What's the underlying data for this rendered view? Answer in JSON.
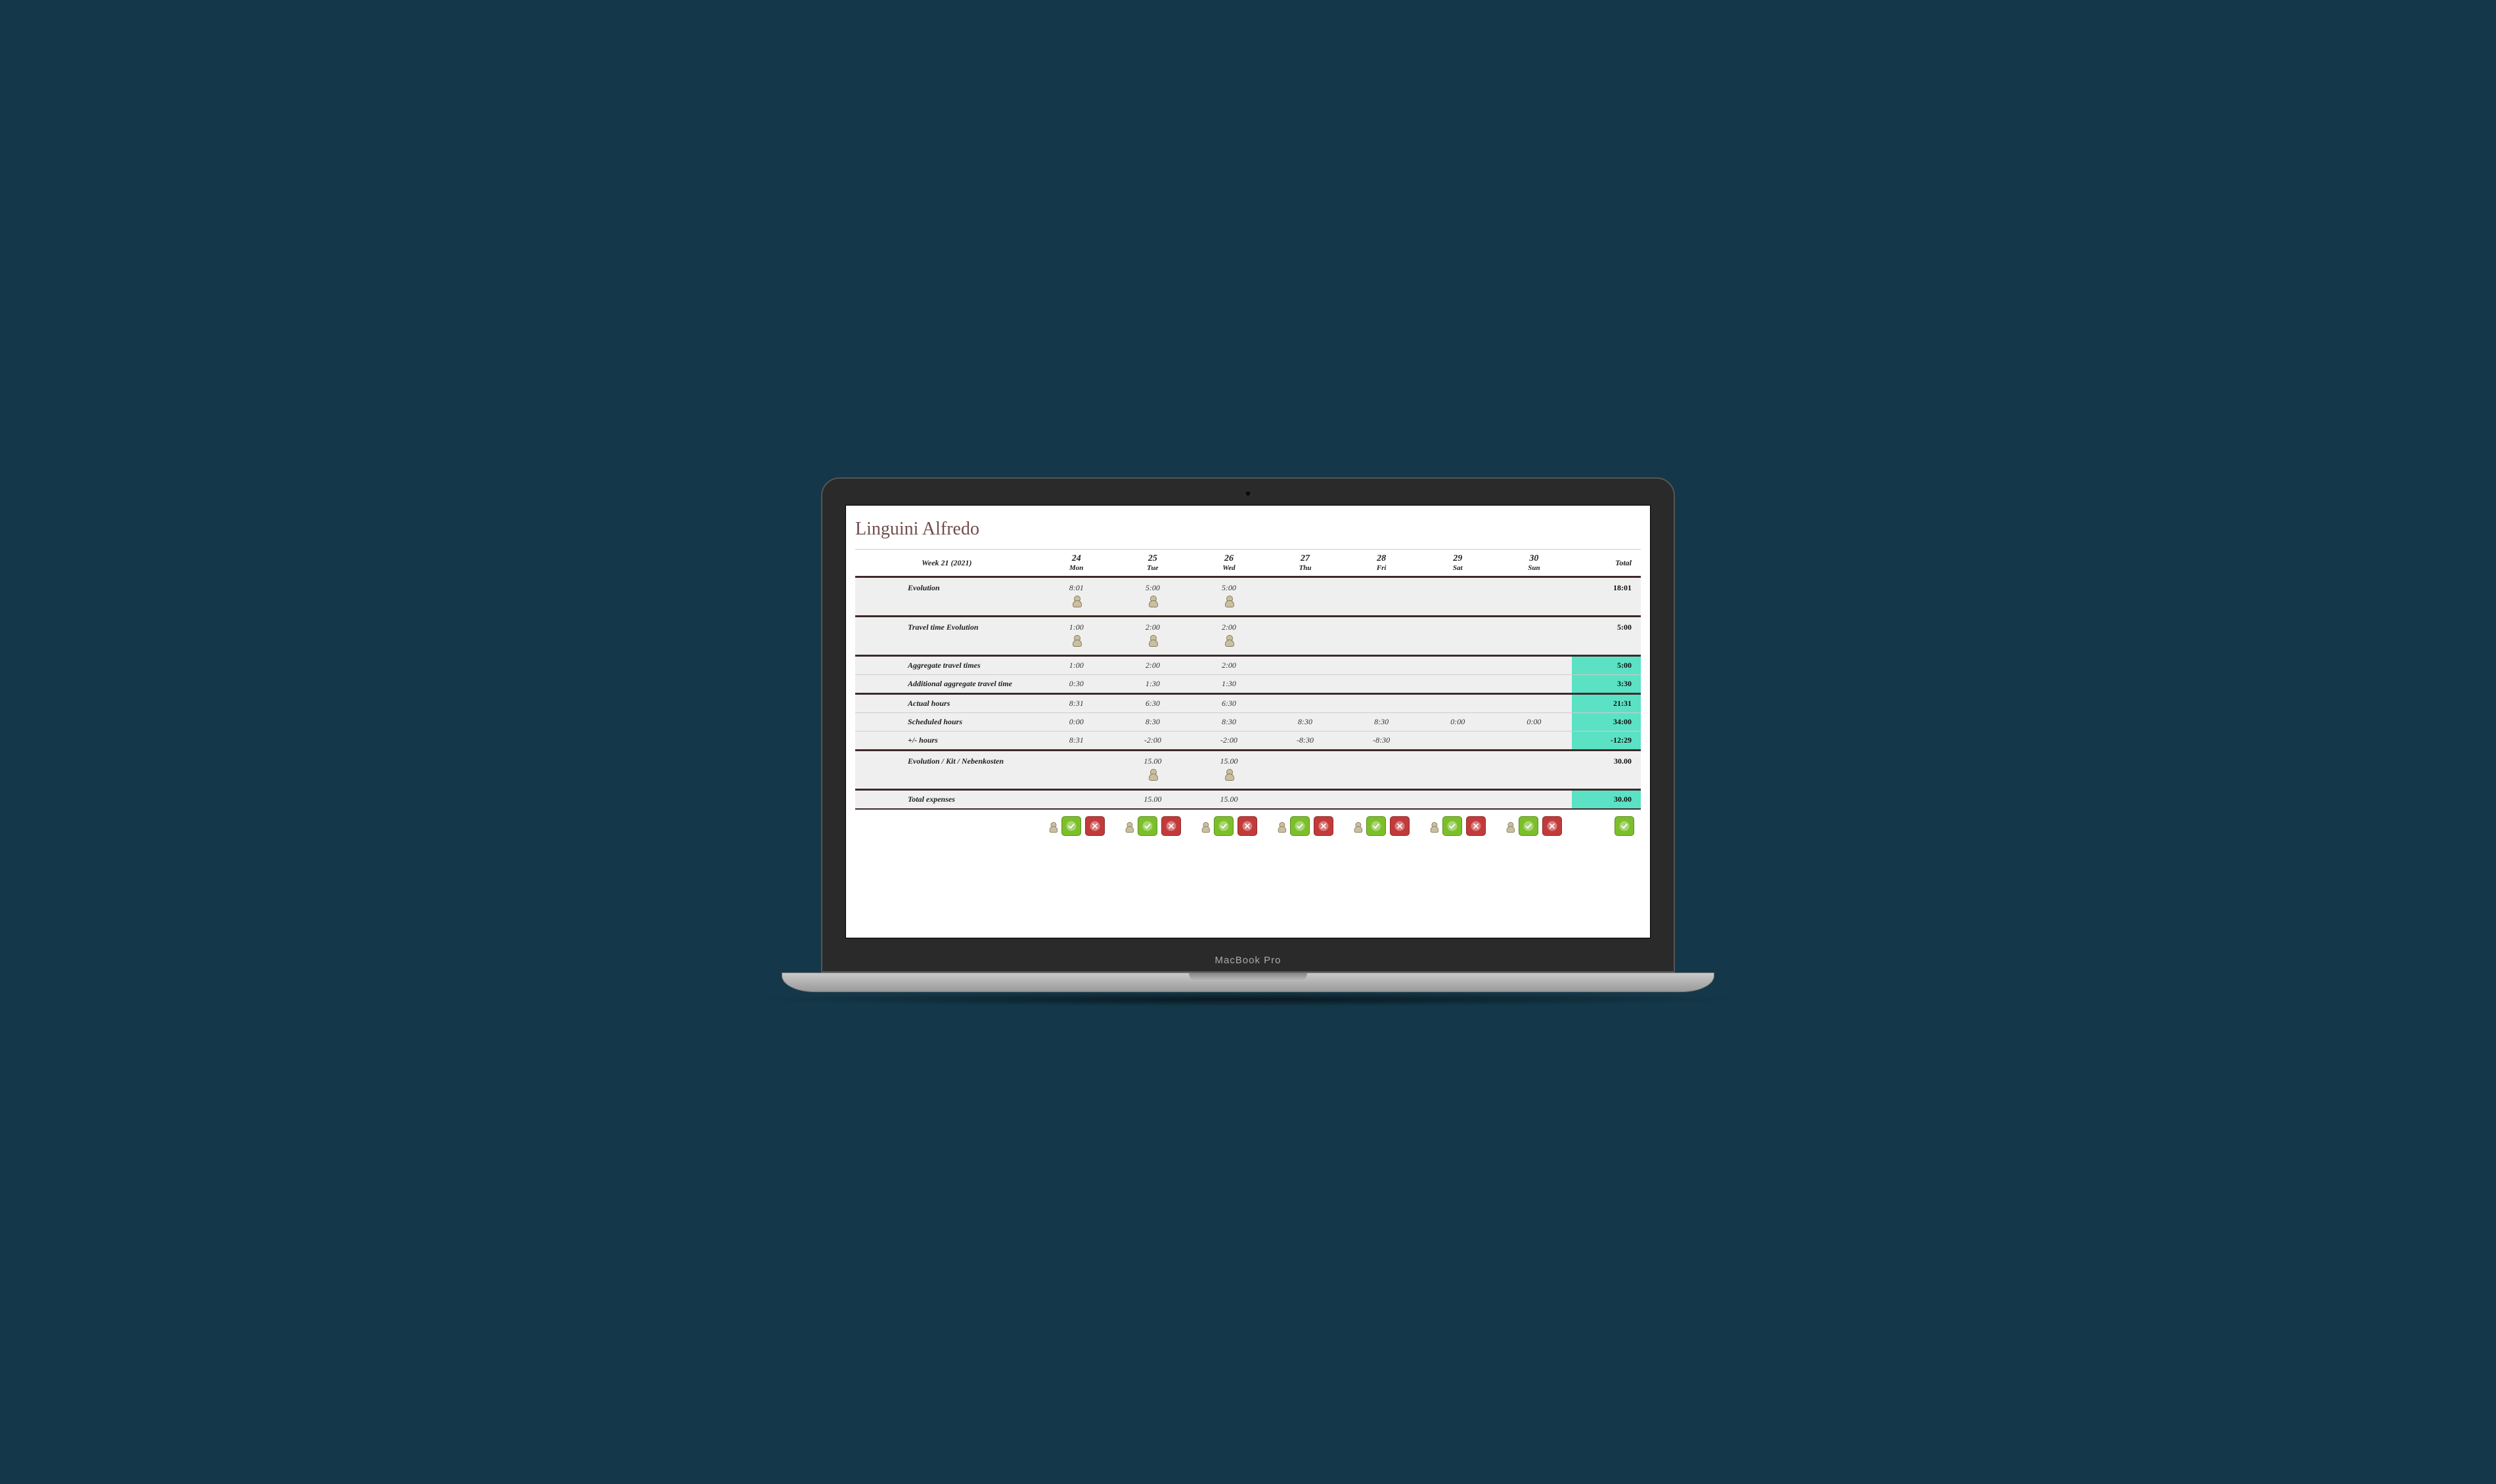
{
  "title": "Linguini Alfredo",
  "week_label": "Week 21 (2021)",
  "days": [
    {
      "num": "24",
      "name": "Mon"
    },
    {
      "num": "25",
      "name": "Tue"
    },
    {
      "num": "26",
      "name": "Wed"
    },
    {
      "num": "27",
      "name": "Thu"
    },
    {
      "num": "28",
      "name": "Fri"
    },
    {
      "num": "29",
      "name": "Sat"
    },
    {
      "num": "30",
      "name": "Sun"
    }
  ],
  "total_label": "Total",
  "rows": [
    {
      "label": "Evolution",
      "vals": [
        "8:01",
        "5:00",
        "5:00",
        "",
        "",
        "",
        ""
      ],
      "total": "18:01",
      "icon": true,
      "section_top": true,
      "highlight": false
    },
    {
      "label": "Travel time Evolution",
      "vals": [
        "1:00",
        "2:00",
        "2:00",
        "",
        "",
        "",
        ""
      ],
      "total": "5:00",
      "icon": true,
      "section_top": true,
      "highlight": false
    },
    {
      "label": "Aggregate travel times",
      "vals": [
        "1:00",
        "2:00",
        "2:00",
        "",
        "",
        "",
        ""
      ],
      "total": "5:00",
      "icon": false,
      "section_top": true,
      "highlight": true
    },
    {
      "label": "Additional aggregate travel time",
      "vals": [
        "0:30",
        "1:30",
        "1:30",
        "",
        "",
        "",
        ""
      ],
      "total": "3:30",
      "icon": false,
      "section_top": false,
      "highlight": true
    },
    {
      "label": "Actual hours",
      "vals": [
        "8:31",
        "6:30",
        "6:30",
        "",
        "",
        "",
        ""
      ],
      "total": "21:31",
      "icon": false,
      "section_top": true,
      "highlight": true
    },
    {
      "label": "Scheduled hours",
      "vals": [
        "0:00",
        "8:30",
        "8:30",
        "8:30",
        "8:30",
        "0:00",
        "0:00"
      ],
      "total": "34:00",
      "icon": false,
      "section_top": false,
      "highlight": true
    },
    {
      "label": "+/- hours",
      "vals": [
        "8:31",
        "-2:00",
        "-2:00",
        "-8:30",
        "-8:30",
        "",
        ""
      ],
      "total": "-12:29",
      "icon": false,
      "section_top": false,
      "highlight": true
    },
    {
      "label": "Evolution / Kit / Nebenkosten",
      "vals": [
        "",
        "15.00",
        "15.00",
        "",
        "",
        "",
        ""
      ],
      "total": "30.00",
      "icon": true,
      "section_top": true,
      "highlight": false
    },
    {
      "label": "Total expenses",
      "vals": [
        "",
        "15.00",
        "15.00",
        "",
        "",
        "",
        ""
      ],
      "total": "30.00",
      "icon": false,
      "section_top": true,
      "highlight": true
    }
  ],
  "device_label": "MacBook Pro"
}
